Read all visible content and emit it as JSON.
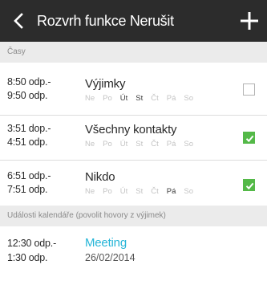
{
  "header": {
    "title": "Rozvrh funkce Nerušit"
  },
  "sections": {
    "times_label": "Časy",
    "calendar_label": "Události kalendáře (povolit hovory z výjimek)"
  },
  "schedules": [
    {
      "start": "8:50 odp.-",
      "end": "9:50 odp.",
      "name": "Výjimky",
      "checked": false,
      "days": [
        {
          "label": "Ne",
          "active": false
        },
        {
          "label": "Po",
          "active": false
        },
        {
          "label": "Út",
          "active": true
        },
        {
          "label": "St",
          "active": true
        },
        {
          "label": "Čt",
          "active": false
        },
        {
          "label": "Pá",
          "active": false
        },
        {
          "label": "So",
          "active": false
        }
      ]
    },
    {
      "start": "3:51 dop.-",
      "end": "4:51 odp.",
      "name": "Všechny kontakty",
      "checked": true,
      "days": [
        {
          "label": "Ne",
          "active": false
        },
        {
          "label": "Po",
          "active": false
        },
        {
          "label": "Út",
          "active": false
        },
        {
          "label": "St",
          "active": false
        },
        {
          "label": "Čt",
          "active": false
        },
        {
          "label": "Pá",
          "active": false
        },
        {
          "label": "So",
          "active": false
        }
      ]
    },
    {
      "start": "6:51 odp.-",
      "end": "7:51 odp.",
      "name": "Nikdo",
      "checked": true,
      "days": [
        {
          "label": "Ne",
          "active": false
        },
        {
          "label": "Po",
          "active": false
        },
        {
          "label": "Út",
          "active": false
        },
        {
          "label": "St",
          "active": false
        },
        {
          "label": "Čt",
          "active": false
        },
        {
          "label": "Pá",
          "active": true
        },
        {
          "label": "So",
          "active": false
        }
      ]
    }
  ],
  "event": {
    "start": "12:30 odp.-",
    "end": "1:30 odp.",
    "name": "Meeting",
    "date": "26/02/2014"
  },
  "colors": {
    "topbar": "#2c2c2c",
    "check_green": "#54b948",
    "meeting_blue": "#26b5d7"
  },
  "icons": {
    "back": "chevron-left-icon",
    "add": "plus-icon",
    "check": "checkmark-icon"
  }
}
